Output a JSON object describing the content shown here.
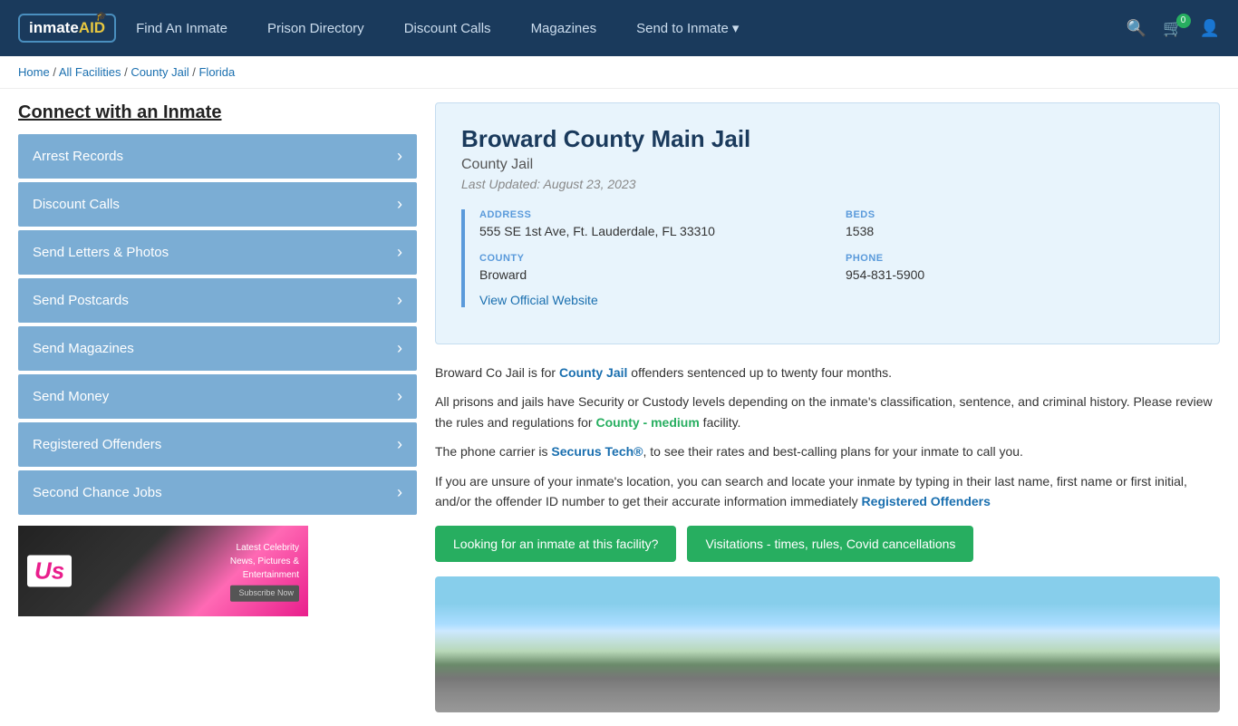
{
  "nav": {
    "logo_text": "inmate",
    "logo_aid": "AID",
    "links": [
      {
        "label": "Find An Inmate",
        "id": "find-inmate"
      },
      {
        "label": "Prison Directory",
        "id": "prison-directory"
      },
      {
        "label": "Discount Calls",
        "id": "discount-calls"
      },
      {
        "label": "Magazines",
        "id": "magazines"
      },
      {
        "label": "Send to Inmate",
        "id": "send-to-inmate"
      }
    ],
    "cart_count": "0",
    "send_arrow": "▾"
  },
  "breadcrumb": {
    "home": "Home",
    "separator1": " / ",
    "all_facilities": "All Facilities",
    "separator2": " / ",
    "county_jail": "County Jail",
    "separator3": " / ",
    "state": "Florida"
  },
  "sidebar": {
    "title": "Connect with an Inmate",
    "items": [
      {
        "label": "Arrest Records",
        "id": "arrest-records"
      },
      {
        "label": "Discount Calls",
        "id": "discount-calls"
      },
      {
        "label": "Send Letters & Photos",
        "id": "send-letters"
      },
      {
        "label": "Send Postcards",
        "id": "send-postcards"
      },
      {
        "label": "Send Magazines",
        "id": "send-magazines"
      },
      {
        "label": "Send Money",
        "id": "send-money"
      },
      {
        "label": "Registered Offenders",
        "id": "registered-offenders"
      },
      {
        "label": "Second Chance Jobs",
        "id": "second-chance-jobs"
      }
    ],
    "arrow": "›",
    "ad": {
      "logo": "Us",
      "line1": "Latest Celebrity",
      "line2": "News, Pictures &",
      "line3": "Entertainment",
      "subscribe": "Subscribe Now"
    }
  },
  "facility": {
    "name": "Broward County Main Jail",
    "type": "County Jail",
    "last_updated": "Last Updated: August 23, 2023",
    "address_label": "ADDRESS",
    "address_value": "555 SE 1st Ave, Ft. Lauderdale, FL 33310",
    "beds_label": "BEDS",
    "beds_value": "1538",
    "county_label": "COUNTY",
    "county_value": "Broward",
    "phone_label": "PHONE",
    "phone_value": "954-831-5900",
    "website_link": "View Official Website",
    "desc1": "Broward Co Jail is for ",
    "desc1_link": "County Jail",
    "desc1_rest": " offenders sentenced up to twenty four months.",
    "desc2": "All prisons and jails have Security or Custody levels depending on the inmate's classification, sentence, and criminal history. Please review the rules and regulations for ",
    "desc2_link": "County - medium",
    "desc2_rest": " facility.",
    "desc3": "The phone carrier is ",
    "desc3_link": "Securus Tech®",
    "desc3_rest": ", to see their rates and best-calling plans for your inmate to call you.",
    "desc4": "If you are unsure of your inmate's location, you can search and locate your inmate by typing in their last name, first name or first initial, and/or the offender ID number to get their accurate information immediately ",
    "desc4_link": "Registered Offenders",
    "btn1": "Looking for an inmate at this facility?",
    "btn2": "Visitations - times, rules, Covid cancellations"
  }
}
